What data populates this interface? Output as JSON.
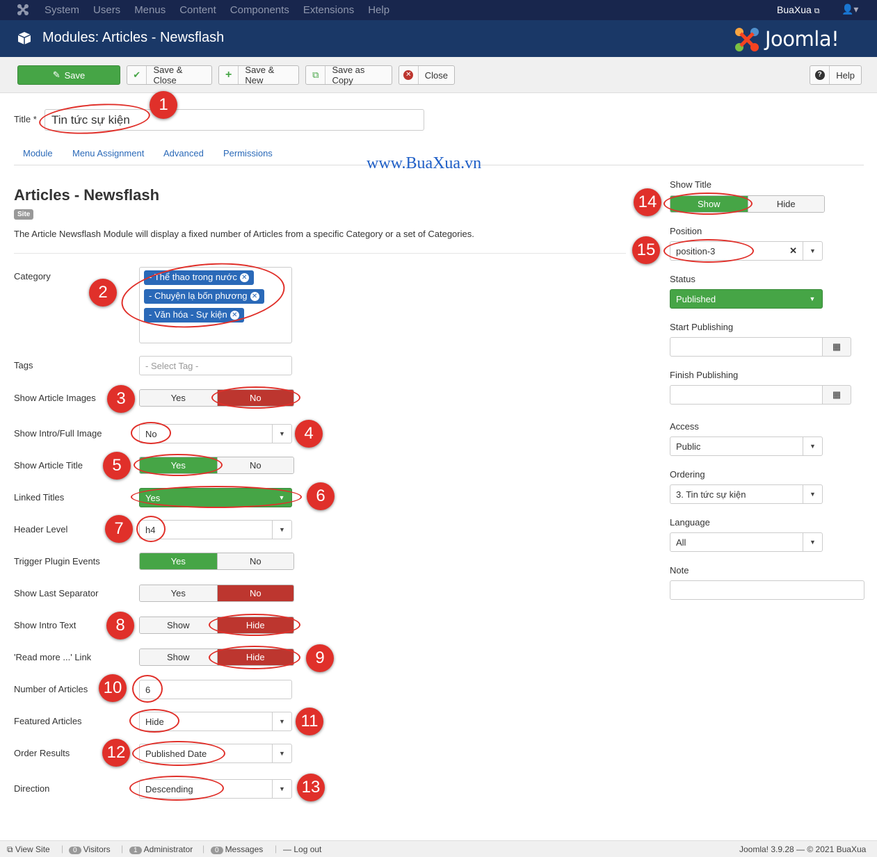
{
  "nav": {
    "menu": [
      "System",
      "Users",
      "Menus",
      "Content",
      "Components",
      "Extensions",
      "Help"
    ],
    "user": "BuaXua"
  },
  "header": {
    "title": "Modules: Articles - Newsflash",
    "brand": "Joomla!"
  },
  "toolbar": {
    "save": "Save",
    "save_close": "Save & Close",
    "save_new": "Save & New",
    "save_copy": "Save as Copy",
    "close": "Close",
    "help": "Help"
  },
  "title_field": {
    "label": "Title *",
    "value": "Tin tức sự kiện"
  },
  "tabs": [
    "Module",
    "Menu Assignment",
    "Advanced",
    "Permissions"
  ],
  "watermark": "www.BuaXua.vn",
  "module": {
    "name": "Articles - Newsflash",
    "badge": "Site",
    "description": "The Article Newsflash Module will display a fixed number of Articles from a specific Category or a set of Categories."
  },
  "fields": {
    "category": {
      "label": "Category",
      "chips": [
        "- Thể thao trong nước",
        "- Chuyện lạ bốn phương",
        "- Văn hóa - Sự kiện"
      ]
    },
    "tags": {
      "label": "Tags",
      "placeholder": "- Select Tag -"
    },
    "show_article_images": {
      "label": "Show Article Images",
      "yes": "Yes",
      "no": "No",
      "selected": "No"
    },
    "show_intro_full_image": {
      "label": "Show Intro/Full Image",
      "value": "No"
    },
    "show_article_title": {
      "label": "Show Article Title",
      "yes": "Yes",
      "no": "No",
      "selected": "Yes"
    },
    "linked_titles": {
      "label": "Linked Titles",
      "value": "Yes"
    },
    "header_level": {
      "label": "Header Level",
      "value": "h4"
    },
    "trigger_plugin_events": {
      "label": "Trigger Plugin Events",
      "yes": "Yes",
      "no": "No",
      "selected": "Yes"
    },
    "show_last_separator": {
      "label": "Show Last Separator",
      "yes": "Yes",
      "no": "No",
      "selected": "No"
    },
    "show_intro_text": {
      "label": "Show Intro Text",
      "show": "Show",
      "hide": "Hide",
      "selected": "Hide"
    },
    "read_more_link": {
      "label": "'Read more ...' Link",
      "show": "Show",
      "hide": "Hide",
      "selected": "Hide"
    },
    "number_of_articles": {
      "label": "Number of Articles",
      "value": "6"
    },
    "featured_articles": {
      "label": "Featured Articles",
      "value": "Hide"
    },
    "order_results": {
      "label": "Order Results",
      "value": "Published Date"
    },
    "direction": {
      "label": "Direction",
      "value": "Descending"
    }
  },
  "sidebar": {
    "show_title": {
      "label": "Show Title",
      "show": "Show",
      "hide": "Hide",
      "selected": "Show"
    },
    "position": {
      "label": "Position",
      "value": "position-3"
    },
    "status": {
      "label": "Status",
      "value": "Published"
    },
    "start_publishing": {
      "label": "Start Publishing",
      "value": ""
    },
    "finish_publishing": {
      "label": "Finish Publishing",
      "value": ""
    },
    "access": {
      "label": "Access",
      "value": "Public"
    },
    "ordering": {
      "label": "Ordering",
      "value": "3. Tin tức sự kiện"
    },
    "language": {
      "label": "Language",
      "value": "All"
    },
    "note": {
      "label": "Note",
      "value": ""
    }
  },
  "annotations": [
    "1",
    "2",
    "3",
    "4",
    "5",
    "6",
    "7",
    "8",
    "9",
    "10",
    "11",
    "12",
    "13",
    "14",
    "15"
  ],
  "statusbar": {
    "view_site": "View Site",
    "visitors_count": "0",
    "visitors": "Visitors",
    "admin_count": "1",
    "admin": "Administrator",
    "messages_count": "0",
    "messages": "Messages",
    "logout": "Log out",
    "version": "Joomla! 3.9.28 — © 2021 BuaXua"
  },
  "colors": {
    "nav": "#18264d",
    "header": "#1a3867",
    "green": "#46a546",
    "red": "#bd362f",
    "blue": "#2a69b8",
    "annotation": "#e0302a"
  }
}
